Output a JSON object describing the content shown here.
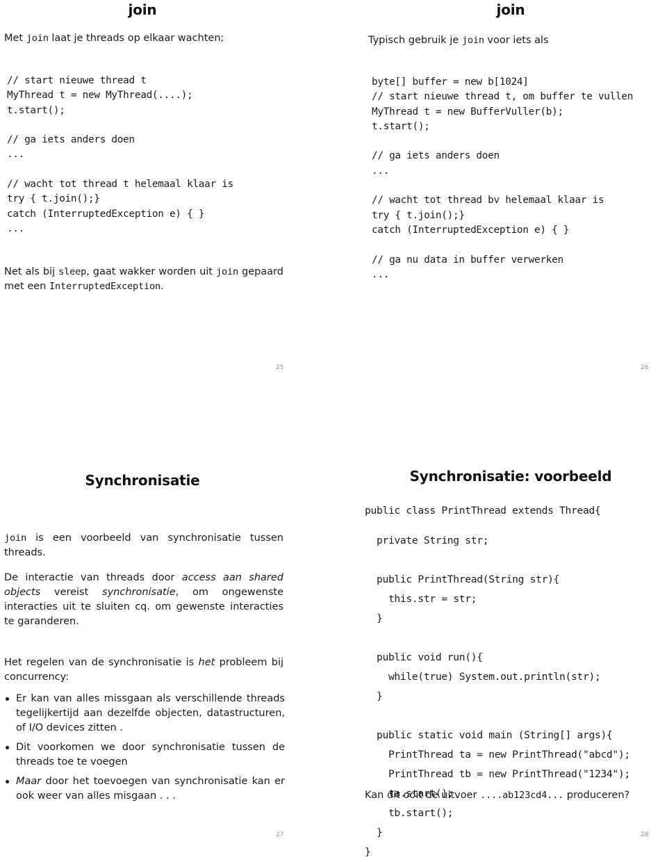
{
  "slides": [
    {
      "id": "slide-join-1",
      "page": "25",
      "title": "join",
      "intro_html": "Met <code>join</code> laat je threads op elkaar wachten;",
      "code": "// start nieuwe thread t\nMyThread t = new MyThread(....);\nt.start();\n\n// ga iets anders doen\n...\n\n// wacht tot thread t helemaal klaar is\ntry { t.join();}\ncatch (InterruptedException e) { }\n...",
      "outro_html": "Net als bij <code>sleep</code>, gaat wakker worden uit <code>join</code> gepaard met een <code>InterruptedException</code>."
    },
    {
      "id": "slide-join-2",
      "page": "26",
      "title": "join",
      "intro_html": "Typisch gebruik je <code>join</code> voor iets als",
      "code": "byte[] buffer = new b[1024]\n// start nieuwe thread t, om buffer te vullen\nMyThread t = new BufferVuller(b);\nt.start();\n\n// ga iets anders doen\n...\n\n// wacht tot thread bv helemaal klaar is\ntry { t.join();}\ncatch (InterruptedException e) { }\n\n// ga nu data in buffer verwerken\n..."
    },
    {
      "id": "slide-synchronisatie",
      "page": "27",
      "title": "Synchronisatie",
      "para_1_html": "<code>join</code> is een voorbeeld van synchronisatie tussen threads.",
      "para_2_html": "De interactie van threads door <span class=\"it\">access aan shared objects</span> vereist <span class=\"it\">synchronisatie</span>, om ongewenste interacties uit te sluiten cq. om gewenste interacties te garanderen.",
      "para_3_html": "Het regelen van de synchronisatie is <span class=\"it\">het</span> probleem bij concurrency:",
      "bullets_html": [
        "Er kan van alles missgaan als verschillende threads tegelijkertijd aan dezelfde objecten, datastructuren, of I/O devices zitten .",
        "Dit voorkomen we door synchronisatie tussen de threads toe te voegen",
        "<span class=\"it\">Maar</span> door het toevoegen van synchronisatie kan er ook weer van alles misgaan . . ."
      ]
    },
    {
      "id": "slide-synchronisatie-voorbeeld",
      "page": "28",
      "title": "Synchronisatie: voorbeeld",
      "code_head": "public class PrintThread extends Thread{",
      "code": "  private String str;\n\n  public PrintThread(String str){\n    this.str = str;\n  }\n\n  public void run(){\n    while(true) System.out.println(str);\n  }\n\n  public static void main (String[] args){\n    PrintThread ta = new PrintThread(\"abcd\");\n    PrintThread tb = new PrintThread(\"1234\");\n    ta.start();\n    tb.start();\n  }\n}",
      "question_html": "Kan dit ooit de uitvoer <code>....ab123cd4...</code> produceren?"
    }
  ],
  "colors": {
    "text": "#1a1a1a",
    "page_number": "#8d8d8d",
    "background": "#ffffff"
  }
}
